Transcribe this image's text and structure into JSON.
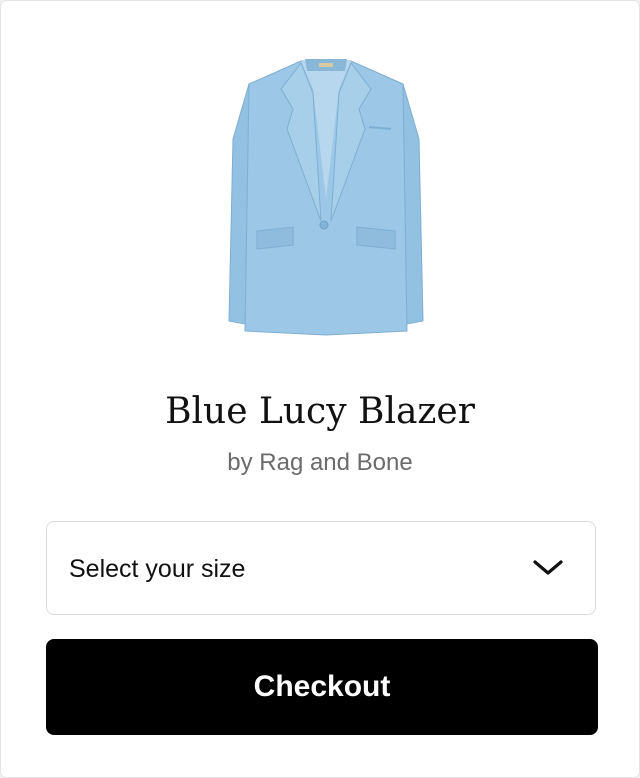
{
  "product": {
    "title": "Blue Lucy Blazer",
    "brand": "by Rag and Bone",
    "image_icon": "blazer-image",
    "color": "#9cc7e6"
  },
  "size_select": {
    "label": "Select your size",
    "icon": "chevron-down-icon"
  },
  "checkout": {
    "label": "Checkout",
    "background": "#000000",
    "text_color": "#ffffff"
  }
}
